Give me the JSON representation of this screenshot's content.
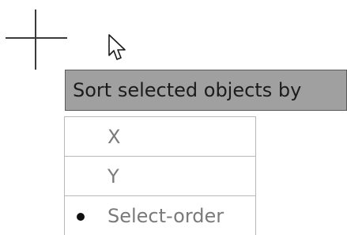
{
  "cursor": {
    "icon": "arrow-pointer-icon"
  },
  "crosshair": {
    "icon": "crosshair-icon"
  },
  "prompt": {
    "label": "Sort selected objects by"
  },
  "options": [
    {
      "label": "X",
      "selected": false
    },
    {
      "label": "Y",
      "selected": false
    },
    {
      "label": "Select-order",
      "selected": true
    }
  ],
  "colors": {
    "prompt_background": "#a0a0a0",
    "option_text": "#7a7a7a",
    "bullet": "#111111"
  }
}
